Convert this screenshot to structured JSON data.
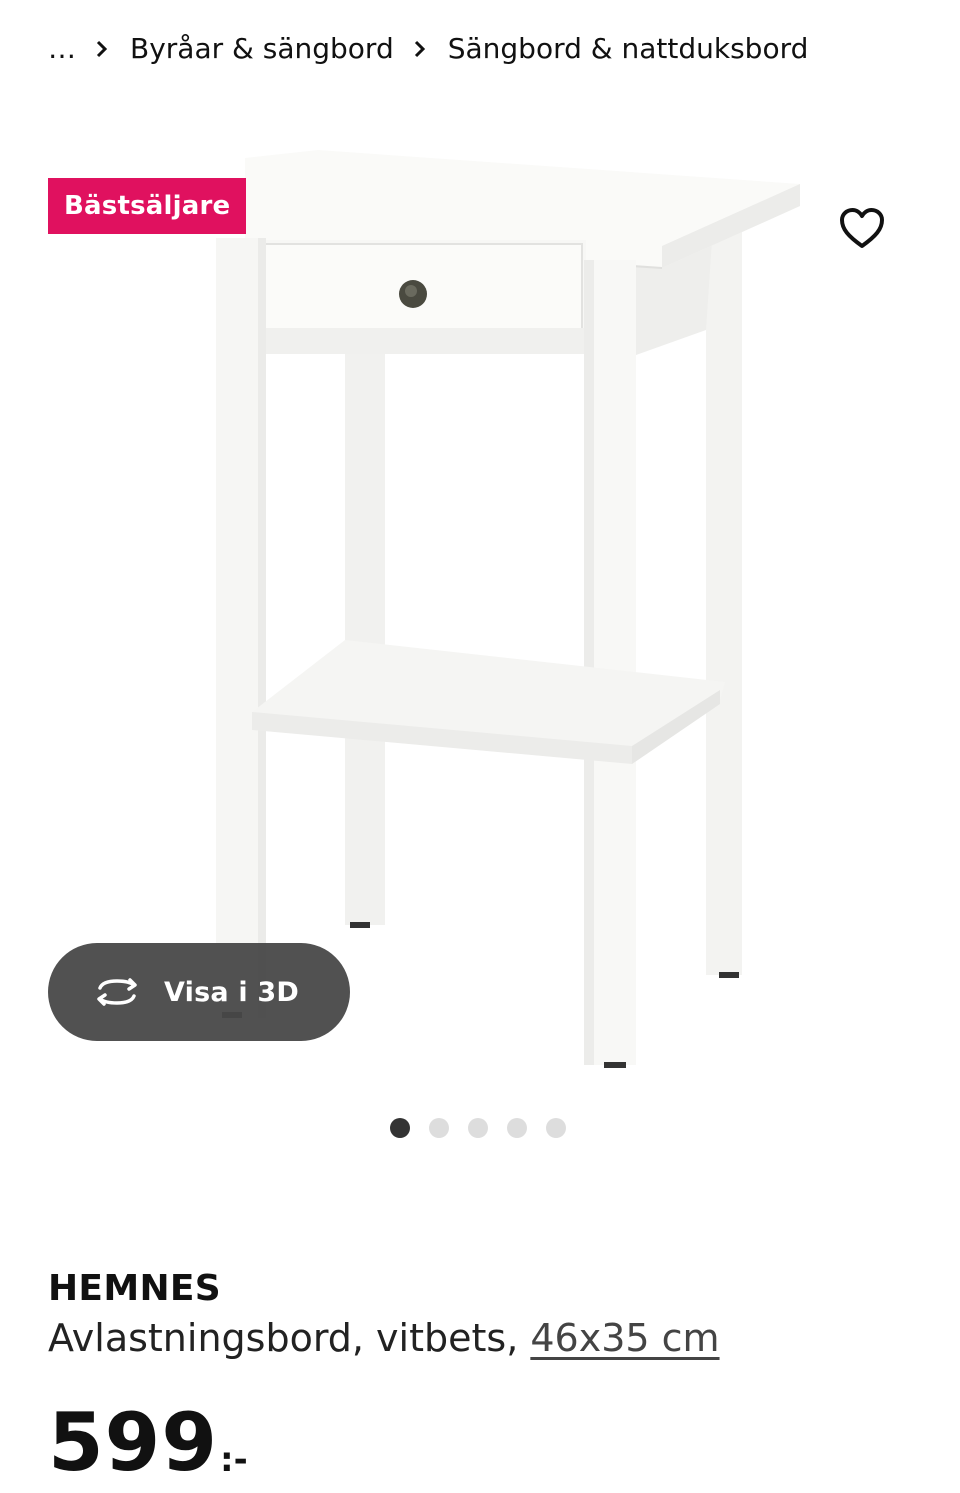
{
  "breadcrumb": {
    "items": [
      "…",
      "Byråar & sängbord",
      "Sängbord & nattduksbord"
    ]
  },
  "gallery": {
    "badge": "Bästsäljare",
    "badge_color": "#e0115f",
    "favorite_icon": "heart-outline-icon",
    "view3d_label": "Visa i 3D",
    "view3d_icon": "rotate-3d-icon",
    "image_count": 5,
    "active_index": 1
  },
  "product": {
    "name": "HEMNES",
    "description": "Avlastningsbord, vitbets, ",
    "size": "46x35 cm",
    "price": "599",
    "price_suffix": ":-"
  }
}
